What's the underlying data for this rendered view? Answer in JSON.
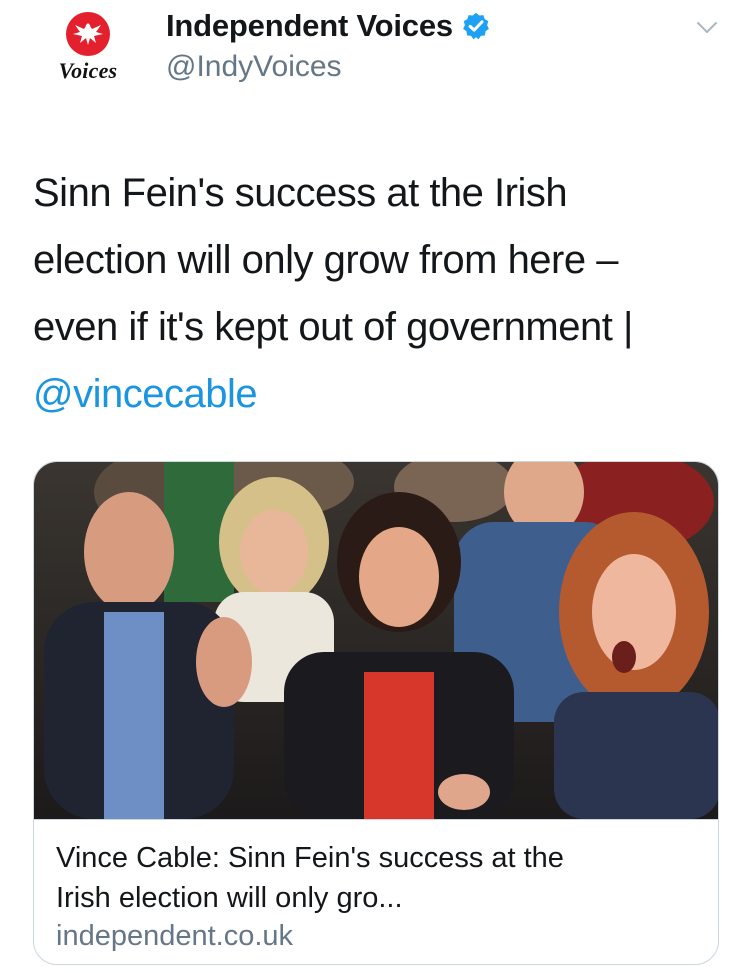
{
  "author": {
    "display_name": "Independent Voices",
    "handle": "@IndyVoices",
    "avatar_label": "Voices",
    "verified": true
  },
  "tweet": {
    "text_lines": [
      "Sinn Fein's success at the Irish",
      "election will only grow from here –",
      "even if it's kept out of government |"
    ],
    "mention": "@vincecable"
  },
  "card": {
    "title_lines": [
      "Vince Cable: Sinn Fein's success at the",
      "Irish election will only gro..."
    ],
    "domain": "independent.co.uk"
  },
  "colors": {
    "link": "#1b95e0",
    "secondary_text": "#657786",
    "border": "#ccd6dd",
    "brand_red": "#e4202e"
  },
  "icons": {
    "avatar": "independent-eagle-logo",
    "verified": "verified-badge-icon",
    "menu": "chevron-down-icon"
  }
}
